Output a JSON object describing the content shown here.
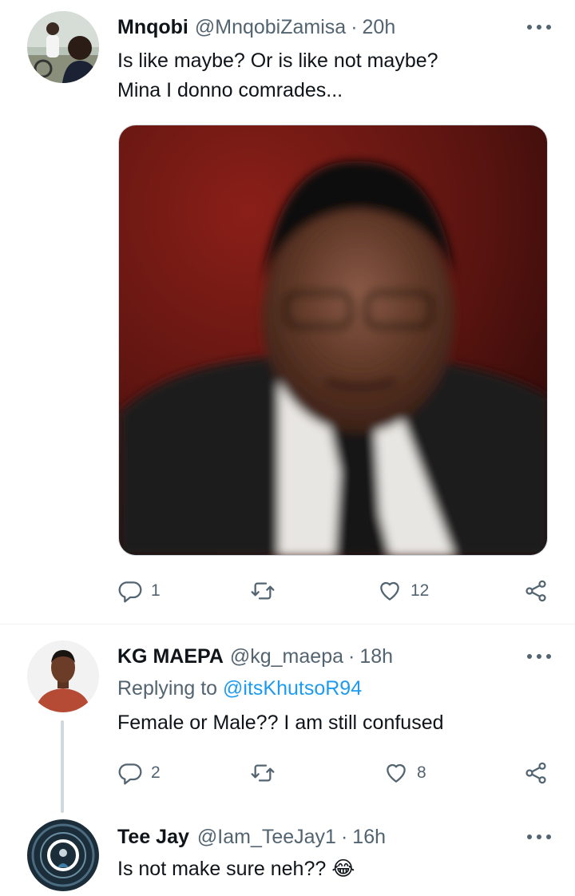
{
  "tweets": [
    {
      "name": "Mnqobi",
      "handle": "@MnqobiZamisa",
      "separator": "·",
      "time": "20h",
      "lines": [
        "Is like maybe? Or is like not maybe?",
        "Mina I donno comrades..."
      ],
      "reply_count": "1",
      "retweet_count": "",
      "like_count": "12"
    },
    {
      "name": "KG MAEPA",
      "handle": "@kg_maepa",
      "separator": "·",
      "time": "18h",
      "replying_prefix": "Replying to ",
      "replying_mention": "@itsKhutsoR94",
      "lines": [
        "Female or Male?? I am still confused"
      ],
      "reply_count": "2",
      "retweet_count": "",
      "like_count": "8"
    },
    {
      "name": "Tee Jay",
      "name_emoji": "",
      "handle": "@Iam_TeeJay1",
      "separator": "·",
      "time": "16h",
      "lines": [
        "Is not make sure neh?? 😂"
      ]
    }
  ],
  "icons": {
    "reply": "reply-icon",
    "retweet": "retweet-icon",
    "like": "heart-icon",
    "share": "share-icon",
    "more": "more-icon"
  },
  "colors": {
    "text": "#0f1419",
    "secondary": "#536471",
    "link": "#1d9bf0",
    "divider": "#eff3f4"
  }
}
